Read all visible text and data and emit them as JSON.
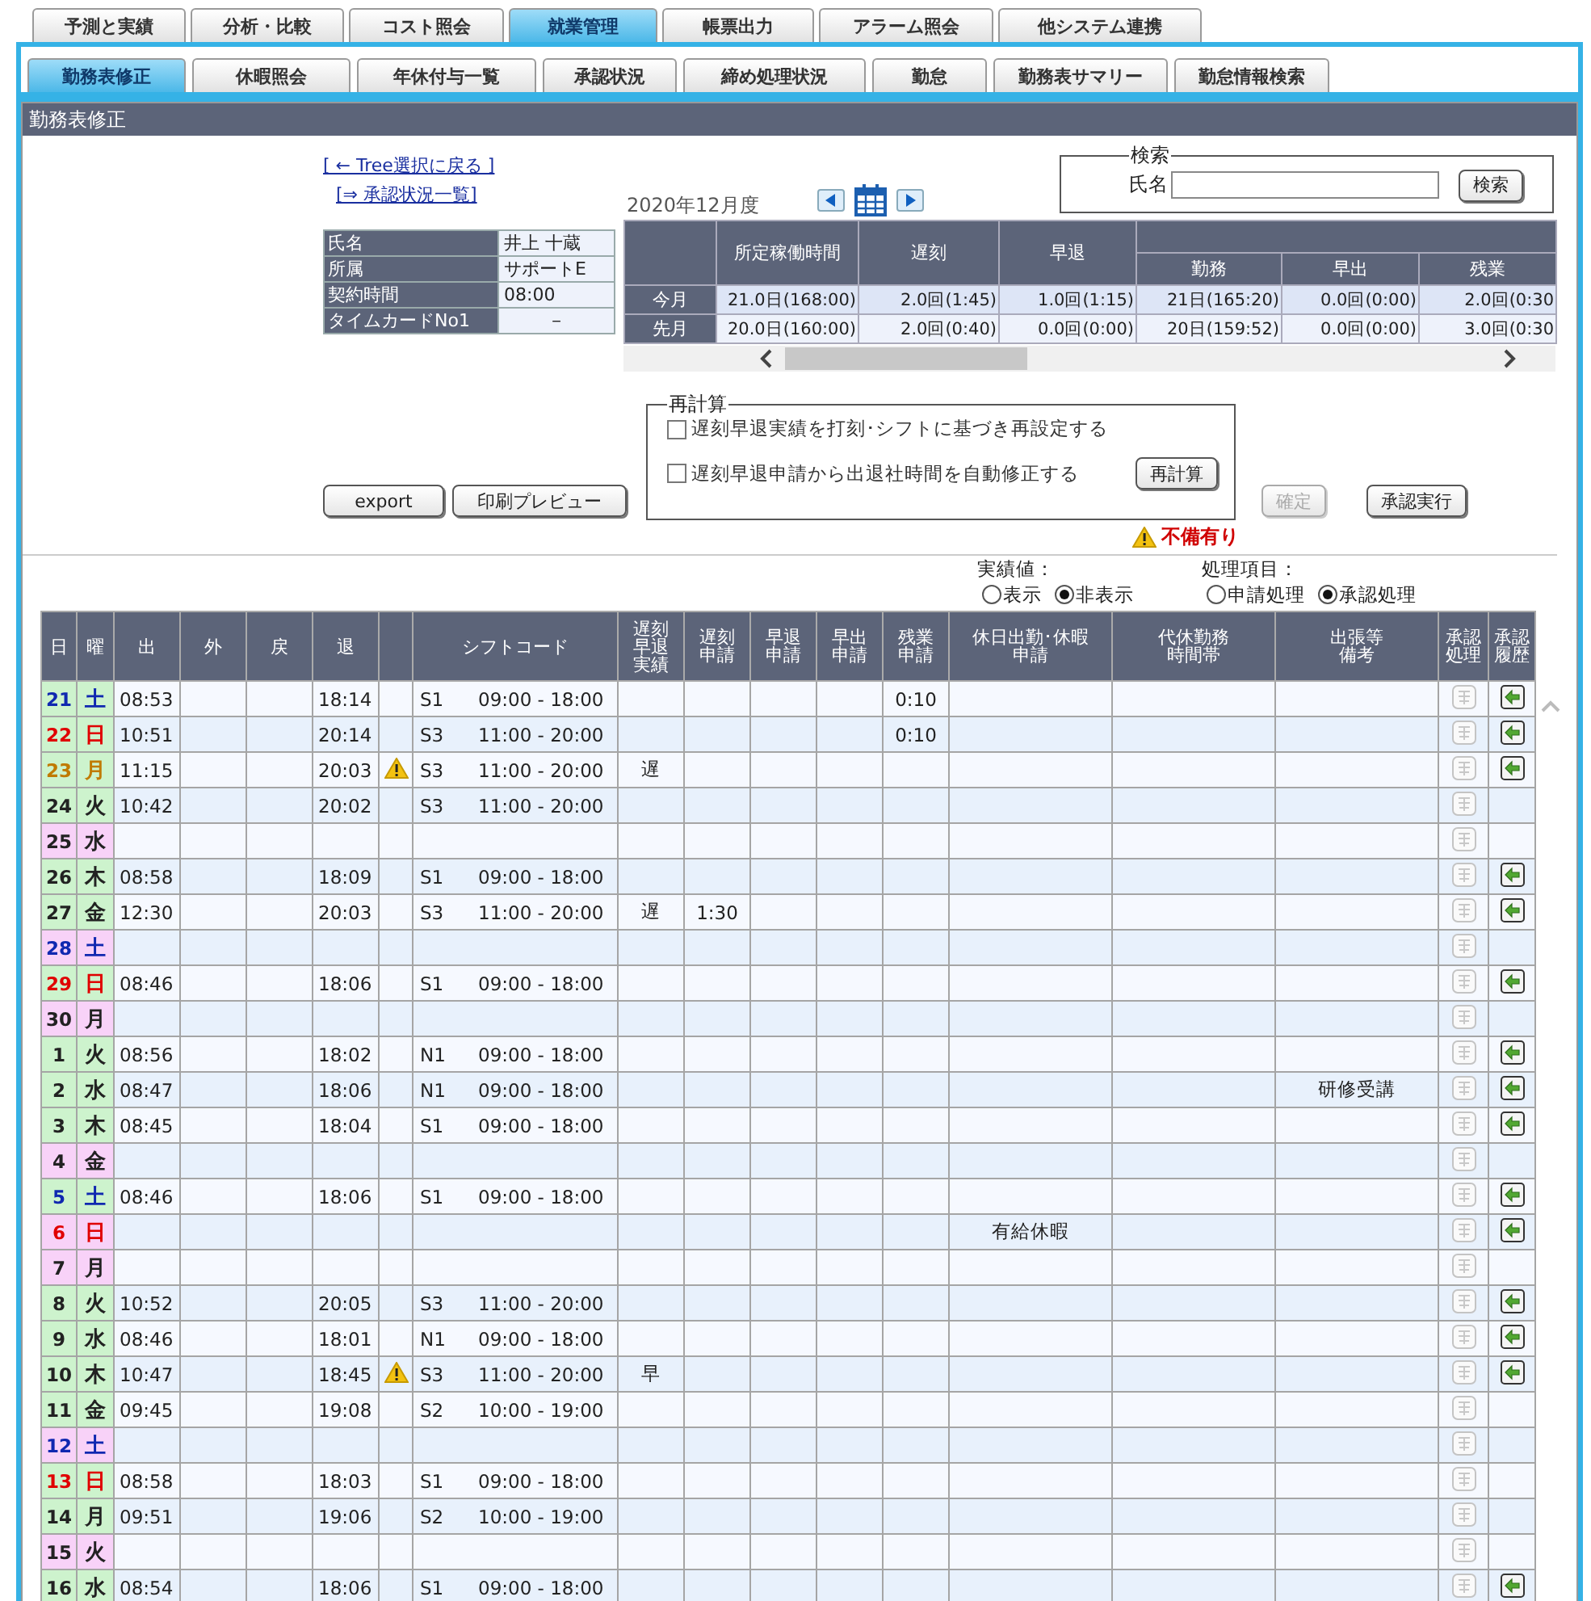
{
  "top_tabs": [
    {
      "label": "予測と実績",
      "selected": false
    },
    {
      "label": "分析・比較",
      "selected": false
    },
    {
      "label": "コスト照会",
      "selected": false
    },
    {
      "label": "就業管理",
      "selected": true
    },
    {
      "label": "帳票出力",
      "selected": false
    },
    {
      "label": "アラーム照会",
      "selected": false
    },
    {
      "label": "他システム連携",
      "selected": false
    }
  ],
  "sub_tabs": [
    {
      "label": "勤務表修正",
      "selected": true
    },
    {
      "label": "休暇照会",
      "selected": false
    },
    {
      "label": "年休付与一覧",
      "selected": false
    },
    {
      "label": "承認状況",
      "selected": false
    },
    {
      "label": "締め処理状況",
      "selected": false
    },
    {
      "label": "勤怠",
      "selected": false
    },
    {
      "label": "勤務表サマリー",
      "selected": false
    },
    {
      "label": "勤怠情報検索",
      "selected": false
    }
  ],
  "panel": {
    "title": "勤務表修正"
  },
  "links": [
    "[ ← Tree選択に戻る ]",
    "[⇒ 承認状況一覧]"
  ],
  "month": "2020年12月度",
  "search": {
    "legend": "検索",
    "label": "氏名",
    "button": "検索"
  },
  "employee": [
    {
      "label": "氏名",
      "value": "井上 十蔵"
    },
    {
      "label": "所属",
      "value": "サポートE"
    },
    {
      "label": "契約時間",
      "value": "08:00"
    },
    {
      "label": "タイムカードNo1",
      "value": "－"
    }
  ],
  "summary": {
    "columns": [
      "所定稼働時間",
      "遅刻",
      "早退"
    ],
    "sub_columns": [
      "勤務",
      "早出",
      "残業"
    ],
    "rows": [
      {
        "label": "今月",
        "values": [
          "21.0日(168:00)",
          "2.0回(1:45)",
          "1.0回(1:15)",
          "21日(165:20)",
          "0.0回(0:00)",
          "2.0回(0:30"
        ]
      },
      {
        "label": "先月",
        "values": [
          "20.0日(160:00)",
          "2.0回(0:40)",
          "0.0回(0:00)",
          "20日(159:52)",
          "0.0回(0:00)",
          "3.0回(0:30"
        ]
      }
    ]
  },
  "buttons": [
    {
      "label": "export",
      "disabled": false
    },
    {
      "label": "印刷プレビュー",
      "disabled": false
    }
  ],
  "recalc": {
    "legend": "再計算",
    "options": [
      {
        "label": "遅刻早退実績を打刻･シフトに基づき再設定する",
        "checked": false
      },
      {
        "label": "遅刻早退申請から出退社時間を自動修正する",
        "checked": false
      }
    ],
    "button": "再計算"
  },
  "actions": [
    {
      "label": "確定",
      "disabled": true
    },
    {
      "label": "承認実行",
      "disabled": false
    }
  ],
  "warning": "不備有り",
  "display_options": [
    {
      "label": "実績値：",
      "options": [
        {
          "label": "表示",
          "selected": false
        },
        {
          "label": "非表示",
          "selected": true
        }
      ]
    },
    {
      "label": "処理項目：",
      "options": [
        {
          "label": "申請処理",
          "selected": false
        },
        {
          "label": "承認処理",
          "selected": true
        }
      ]
    }
  ],
  "table": {
    "columns": [
      "日",
      "曜",
      "出",
      "外",
      "戻",
      "退",
      "シフトコード",
      "遅刻早退実績",
      "遅刻申請",
      "早退申請",
      "早出申請",
      "残業申請",
      "休日出勤･休暇申請",
      "代休勤務時間帯",
      "出張等備考",
      "承認処理",
      "承認履歴"
    ],
    "rows": [
      {
        "day": "21",
        "weekday": "土",
        "color": "#1028b0",
        "day_off": false,
        "in": "08:53",
        "out": "18:14",
        "warning": false,
        "shift_code": "S1",
        "shift_time": "09:00 - 18:00",
        "overtime_request": "0:10",
        "history": true
      },
      {
        "day": "22",
        "weekday": "日",
        "color": "#e00000",
        "day_off": false,
        "in": "10:51",
        "out": "20:14",
        "warning": false,
        "shift_code": "S3",
        "shift_time": "11:00 - 20:00",
        "overtime_request": "0:10",
        "history": true
      },
      {
        "day": "23",
        "weekday": "月",
        "color": "#c07a00",
        "day_off": false,
        "in": "11:15",
        "out": "20:03",
        "warning": true,
        "shift_code": "S3",
        "shift_time": "11:00 - 20:00",
        "result": "遅",
        "history": true
      },
      {
        "day": "24",
        "weekday": "火",
        "color": "#222222",
        "day_off": false,
        "in": "10:42",
        "out": "20:02",
        "warning": false,
        "shift_code": "S3",
        "shift_time": "11:00 - 20:00",
        "history": false
      },
      {
        "day": "25",
        "weekday": "水",
        "color": "#222222",
        "day_off": true,
        "warning": false,
        "history": false
      },
      {
        "day": "26",
        "weekday": "木",
        "color": "#222222",
        "day_off": false,
        "in": "08:58",
        "out": "18:09",
        "warning": false,
        "shift_code": "S1",
        "shift_time": "09:00 - 18:00",
        "history": true
      },
      {
        "day": "27",
        "weekday": "金",
        "color": "#222222",
        "day_off": false,
        "in": "12:30",
        "out": "20:03",
        "warning": false,
        "shift_code": "S3",
        "shift_time": "11:00 - 20:00",
        "result": "遅",
        "late_request": "1:30",
        "history": true
      },
      {
        "day": "28",
        "weekday": "土",
        "color": "#1028b0",
        "day_off": true,
        "warning": false,
        "history": false
      },
      {
        "day": "29",
        "weekday": "日",
        "color": "#e00000",
        "day_off": false,
        "in": "08:46",
        "out": "18:06",
        "warning": false,
        "shift_code": "S1",
        "shift_time": "09:00 - 18:00",
        "history": true
      },
      {
        "day": "30",
        "weekday": "月",
        "color": "#222222",
        "day_off": true,
        "warning": false,
        "history": false
      },
      {
        "day": "1",
        "weekday": "火",
        "color": "#222222",
        "day_off": false,
        "in": "08:56",
        "out": "18:02",
        "warning": false,
        "shift_code": "N1",
        "shift_time": "09:00 - 18:00",
        "history": true
      },
      {
        "day": "2",
        "weekday": "水",
        "color": "#222222",
        "day_off": false,
        "in": "08:47",
        "out": "18:06",
        "warning": false,
        "shift_code": "N1",
        "shift_time": "09:00 - 18:00",
        "remarks": "研修受講",
        "history": true
      },
      {
        "day": "3",
        "weekday": "木",
        "color": "#222222",
        "day_off": false,
        "in": "08:45",
        "out": "18:04",
        "warning": false,
        "shift_code": "S1",
        "shift_time": "09:00 - 18:00",
        "history": true
      },
      {
        "day": "4",
        "weekday": "金",
        "color": "#222222",
        "day_off": true,
        "warning": false,
        "history": false
      },
      {
        "day": "5",
        "weekday": "土",
        "color": "#1028b0",
        "day_off": false,
        "in": "08:46",
        "out": "18:06",
        "warning": false,
        "shift_code": "S1",
        "shift_time": "09:00 - 18:00",
        "history": true
      },
      {
        "day": "6",
        "weekday": "日",
        "color": "#e00000",
        "day_off": true,
        "warning": false,
        "holiday_request": "有給休暇",
        "history": true
      },
      {
        "day": "7",
        "weekday": "月",
        "color": "#222222",
        "day_off": true,
        "warning": false,
        "history": false
      },
      {
        "day": "8",
        "weekday": "火",
        "color": "#222222",
        "day_off": false,
        "in": "10:52",
        "out": "20:05",
        "warning": false,
        "shift_code": "S3",
        "shift_time": "11:00 - 20:00",
        "history": true
      },
      {
        "day": "9",
        "weekday": "水",
        "color": "#222222",
        "day_off": false,
        "in": "08:46",
        "out": "18:01",
        "warning": false,
        "shift_code": "N1",
        "shift_time": "09:00 - 18:00",
        "history": true
      },
      {
        "day": "10",
        "weekday": "木",
        "color": "#222222",
        "day_off": false,
        "in": "10:47",
        "out": "18:45",
        "warning": true,
        "shift_code": "S3",
        "shift_time": "11:00 - 20:00",
        "result": "早",
        "history": true
      },
      {
        "day": "11",
        "weekday": "金",
        "color": "#222222",
        "day_off": false,
        "in": "09:45",
        "out": "19:08",
        "warning": false,
        "shift_code": "S2",
        "shift_time": "10:00 - 19:00",
        "history": false
      },
      {
        "day": "12",
        "weekday": "土",
        "color": "#1028b0",
        "day_off": true,
        "warning": false,
        "history": false
      },
      {
        "day": "13",
        "weekday": "日",
        "color": "#e00000",
        "day_off": false,
        "in": "08:58",
        "out": "18:03",
        "warning": false,
        "shift_code": "S1",
        "shift_time": "09:00 - 18:00",
        "history": false
      },
      {
        "day": "14",
        "weekday": "月",
        "color": "#222222",
        "day_off": false,
        "in": "09:51",
        "out": "19:06",
        "warning": false,
        "shift_code": "S2",
        "shift_time": "10:00 - 19:00",
        "history": false
      },
      {
        "day": "15",
        "weekday": "火",
        "color": "#222222",
        "day_off": true,
        "warning": false,
        "history": false
      },
      {
        "day": "16",
        "weekday": "水",
        "color": "#222222",
        "day_off": false,
        "in": "08:54",
        "out": "18:06",
        "warning": false,
        "shift_code": "S1",
        "shift_time": "09:00 - 18:00",
        "history": true
      }
    ]
  }
}
